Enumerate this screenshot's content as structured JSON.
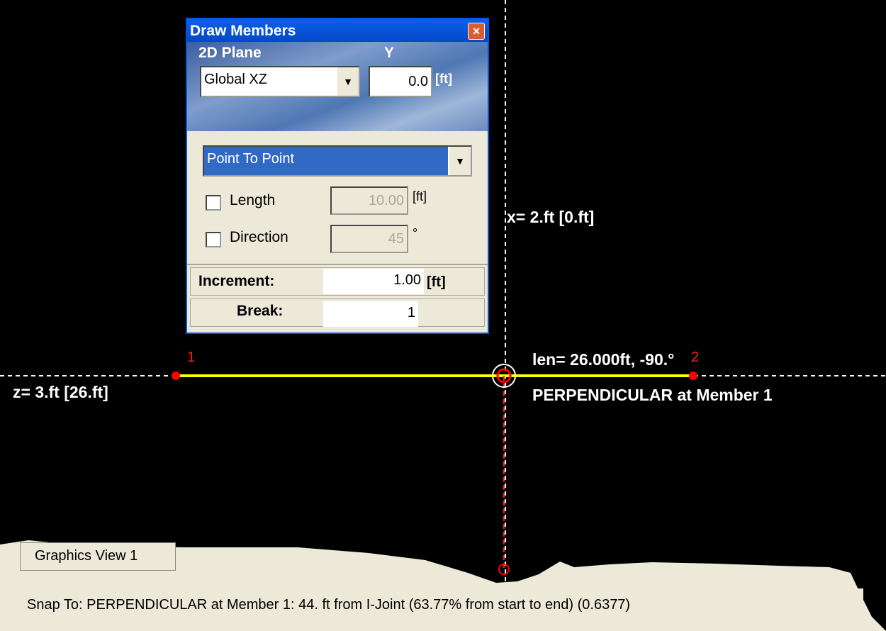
{
  "dialog": {
    "title": "Draw Members",
    "plane_label": "2D Plane",
    "y_label": "Y",
    "plane_value": "Global XZ",
    "y_value": "0.0",
    "y_unit": "[ft]",
    "mode_value": "Point To Point",
    "length_label": "Length",
    "length_value": "10.00",
    "length_unit": "[ft]",
    "direction_label": "Direction",
    "direction_value": "45",
    "direction_unit": "°",
    "increment_label": "Increment:",
    "increment_value": "1.00",
    "increment_unit": "[ft]",
    "break_label": "Break:",
    "break_value": "1"
  },
  "overlay": {
    "x_readout": "x= 2.ft  [0.ft]",
    "z_readout": "z= 3.ft  [26.ft]",
    "len_readout": "len= 26.000ft, -90.°",
    "snap_label": "PERPENDICULAR at  Member 1",
    "node_start_label": "1",
    "node_end_label": "2"
  },
  "tab": {
    "label": "Graphics View 1"
  },
  "status": {
    "text": "Snap To:  PERPENDICULAR at Member 1: 44. ft from I-Joint  (63.77% from start to end) (0.6377)"
  },
  "colors": {
    "background": "#000000",
    "member": "#ffff00",
    "node": "#ff0000",
    "accent": "#0054e3"
  },
  "icons": [
    "close-icon",
    "dropdown-arrow-icon",
    "snap-cursor-icon"
  ]
}
